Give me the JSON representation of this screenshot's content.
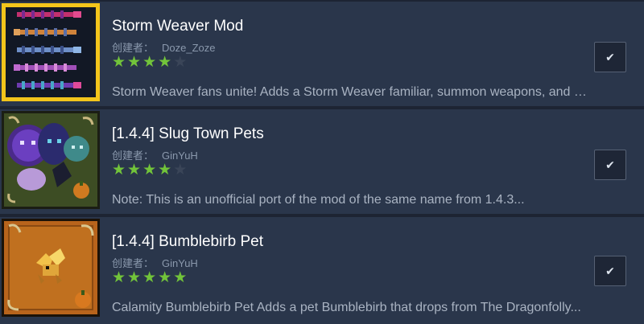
{
  "items": [
    {
      "title": "Storm Weaver Mod",
      "author_label": "创建者：",
      "author": "Doze_Zoze",
      "rating": 4,
      "rating_max": 5,
      "description": "Storm Weaver fans unite! Adds a Storm Weaver familiar, summon weapons, and more...",
      "checked_icon": "checkmark-icon"
    },
    {
      "title": "[1.4.4] Slug Town Pets",
      "author_label": "创建者：",
      "author": "GinYuH",
      "rating": 4,
      "rating_max": 5,
      "description": "Note: This is an unofficial port of the mod of the same name from 1.4.3...",
      "checked_icon": "checkmark-icon"
    },
    {
      "title": "[1.4.4] Bumblebirb Pet",
      "author_label": "创建者：",
      "author": "GinYuH",
      "rating": 5,
      "rating_max": 5,
      "description": "Calamity Bumblebirb Pet Adds a pet Bumblebirb that drops from The Dragonfolly...",
      "checked_icon": "checkmark-icon"
    }
  ],
  "colors": {
    "star_on": "#72c43a",
    "star_off": "#3a4558",
    "item_bg": "#2a364b",
    "thumb_border_gold": "#f3c51b"
  }
}
